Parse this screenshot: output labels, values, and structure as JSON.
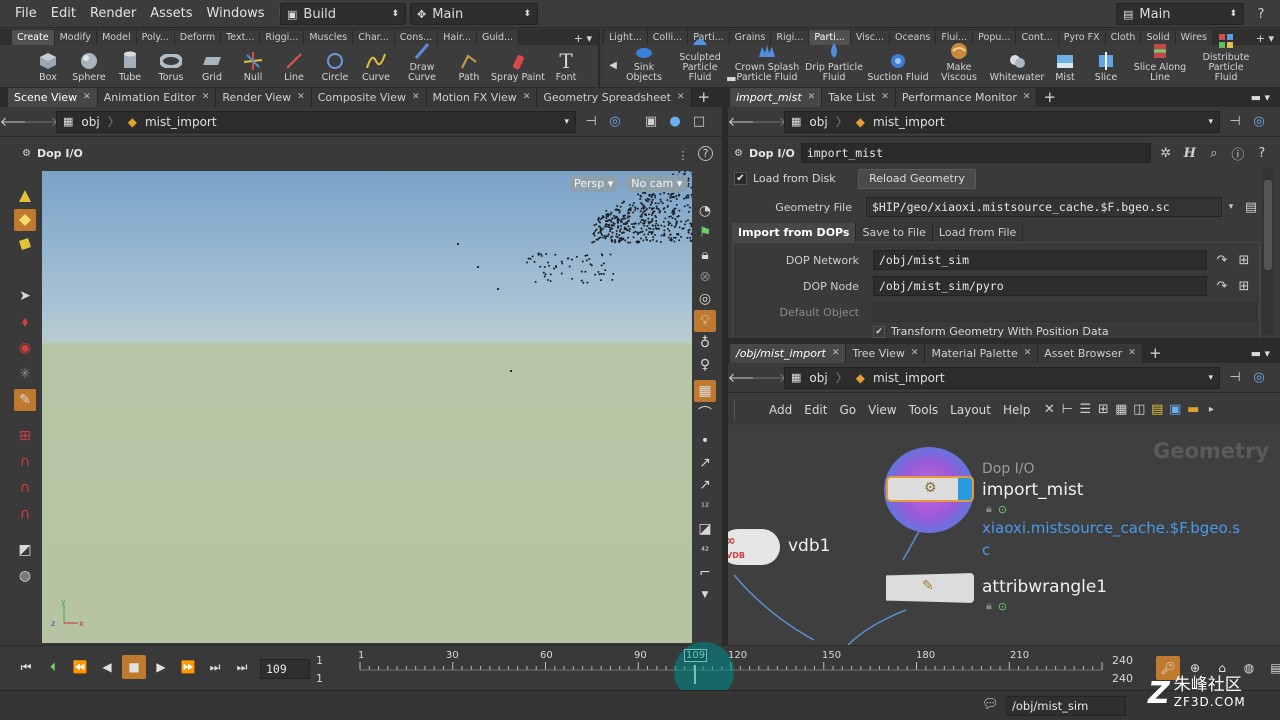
{
  "menubar": {
    "items": [
      "File",
      "Edit",
      "Render",
      "Assets",
      "Windows",
      "Help"
    ],
    "desk_left": "Build",
    "desk_mid": "Main",
    "desk_right": "Main"
  },
  "shelf_left": {
    "tabs": [
      "Create",
      "Modify",
      "Model",
      "Poly...",
      "Deform",
      "Text...",
      "Riggi...",
      "Muscles",
      "Char...",
      "Cons...",
      "Hair...",
      "Guid..."
    ],
    "tools": [
      "Box",
      "Sphere",
      "Tube",
      "Torus",
      "Grid",
      "Null",
      "Line",
      "Circle",
      "Curve",
      "Draw Curve",
      "Path",
      "Spray Paint",
      "Font"
    ]
  },
  "shelf_right": {
    "tabs": [
      "Light...",
      "Colli...",
      "Parti...",
      "Grains",
      "Rigi...",
      "Parti...",
      "Visc...",
      "Oceans",
      "Flui...",
      "Popu...",
      "Cont...",
      "Pyro FX",
      "Cloth",
      "Solid",
      "Wires"
    ],
    "tools": [
      "Sink Objects",
      "Sculpted Particle Fluid",
      "Crown Splash Particle Fluid",
      "Drip Particle Fluid",
      "Suction Fluid",
      "Make Viscous",
      "Whitewater",
      "Mist",
      "Slice",
      "Slice Along Line",
      "Distribute Particle Fluid"
    ]
  },
  "left_pane": {
    "tabs": [
      "Scene View",
      "Animation Editor",
      "Render View",
      "Composite View",
      "Motion FX View",
      "Geometry Spreadsheet"
    ],
    "path": [
      "obj",
      "mist_import"
    ],
    "title": "Dop I/O",
    "view_persp": "Persp",
    "view_cam": "No cam"
  },
  "params": {
    "tabs": [
      "import_mist",
      "Take List",
      "Performance Monitor"
    ],
    "path": [
      "obj",
      "mist_import"
    ],
    "node_type": "Dop I/O",
    "node_name": "import_mist",
    "load_from_disk": "Load from Disk",
    "reload": "Reload Geometry",
    "geo_file_label": "Geometry File",
    "geo_file": "$HIP/geo/xiaoxi.mistsource_cache.$F.bgeo.sc",
    "subtabs": [
      "Import from DOPs",
      "Save to File",
      "Load from File"
    ],
    "dop_network_label": "DOP Network",
    "dop_network": "/obj/mist_sim",
    "dop_node_label": "DOP Node",
    "dop_node": "/obj/mist_sim/pyro",
    "default_object_label": "Default Object",
    "transform_label": "Transform Geometry With Position Data"
  },
  "network": {
    "tabs": [
      "/obj/mist_import",
      "Tree View",
      "Material Palette",
      "Asset Browser"
    ],
    "path": [
      "obj",
      "mist_import"
    ],
    "menu": [
      "Add",
      "Edit",
      "Go",
      "View",
      "Tools",
      "Layout",
      "Help"
    ],
    "context_label": "Geometry",
    "nodes": {
      "dopio_type": "Dop I/O",
      "dopio_name": "import_mist",
      "dopio_file_1": "xiaoxi.mistsource_cache.$F.bgeo.s",
      "dopio_file_2": "c",
      "vdb_name": "vdb1",
      "vdb_badge": "VDB",
      "wrangle_name": "attribwrangle1"
    }
  },
  "timeline": {
    "current_frame": "109",
    "start_1": "1",
    "start_2": "1",
    "ticks": [
      "1",
      "30",
      "60",
      "90",
      "109",
      "120",
      "150",
      "180",
      "210"
    ],
    "end_1": "240",
    "end_2": "240"
  },
  "status": {
    "path": "/obj/mist_sim",
    "watermark_brand": "朱峰社区",
    "watermark_url": "ZF3D.COM"
  }
}
